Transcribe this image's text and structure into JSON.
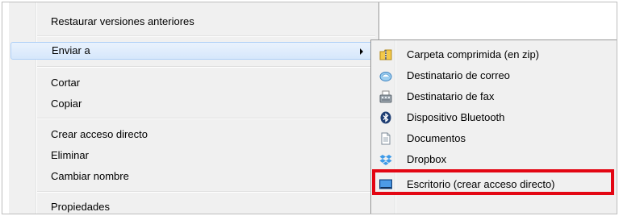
{
  "context_menu": {
    "items": [
      {
        "label": "Restaurar versiones anteriores"
      },
      {
        "label": "Enviar a"
      },
      {
        "label": "Cortar"
      },
      {
        "label": "Copiar"
      },
      {
        "label": "Crear acceso directo"
      },
      {
        "label": "Eliminar"
      },
      {
        "label": "Cambiar nombre"
      },
      {
        "label": "Propiedades"
      }
    ]
  },
  "send_to_menu": {
    "items": [
      {
        "label": "Carpeta comprimida (en zip)",
        "icon": "zip-folder-icon"
      },
      {
        "label": "Destinatario de correo",
        "icon": "mail-recipient-icon"
      },
      {
        "label": "Destinatario de fax",
        "icon": "fax-icon"
      },
      {
        "label": "Dispositivo Bluetooth",
        "icon": "bluetooth-icon"
      },
      {
        "label": "Documentos",
        "icon": "documents-icon"
      },
      {
        "label": "Dropbox",
        "icon": "dropbox-icon"
      },
      {
        "label": "Escritorio (crear acceso directo)",
        "icon": "desktop-icon"
      }
    ]
  },
  "colors": {
    "highlight_box": "#e30613",
    "menu_background": "#f0f0f0",
    "hover_border": "#aecff7"
  }
}
